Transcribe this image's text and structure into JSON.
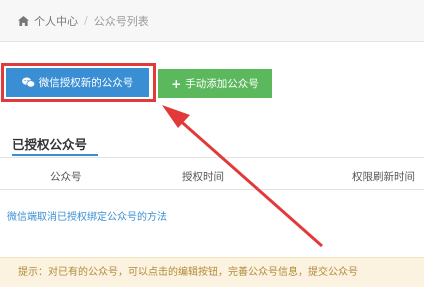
{
  "breadcrumb": {
    "home_label": "个人中心",
    "separator": "/",
    "current": "公众号列表"
  },
  "actions": {
    "wechat_auth_label": "微信授权新的公众号",
    "manual_add_label": "手动添加公众号"
  },
  "section": {
    "title": "已授权公众号"
  },
  "table": {
    "columns": [
      "公众号",
      "授权时间",
      "权限刷新时间"
    ]
  },
  "help_link": "微信端取消已授权绑定公众号的方法",
  "tip": "提示：对已有的公众号，可以点击的编辑按钮，完善公众号信息，提交公众号",
  "colors": {
    "primary": "#3a8fd4",
    "success": "#5cb85c",
    "highlight": "#e23a3a",
    "tip_bg": "#fbf3df"
  },
  "icons": {
    "home": "home-icon",
    "wechat": "wechat-icon",
    "plus": "plus-icon"
  }
}
